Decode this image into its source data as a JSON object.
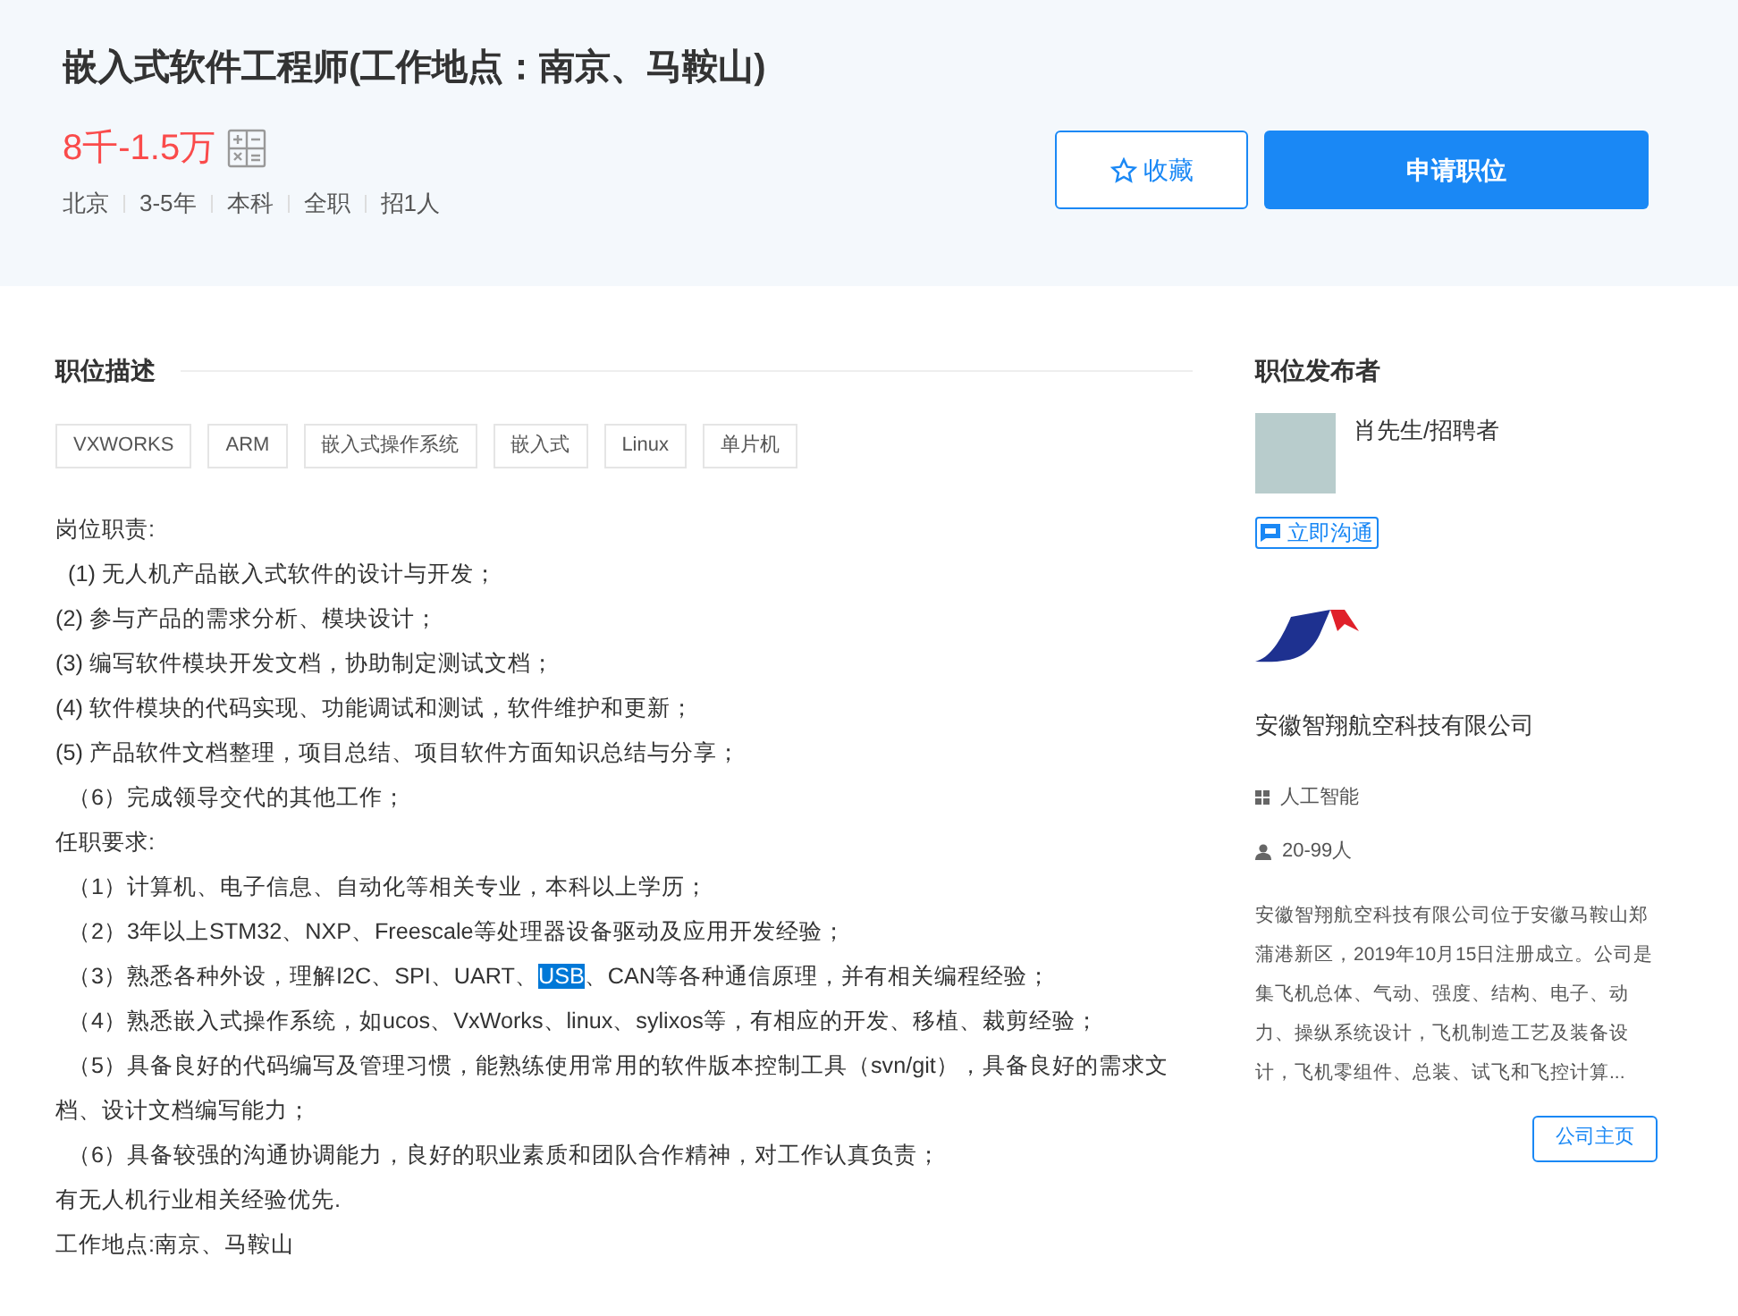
{
  "job": {
    "title": "嵌入式软件工程师(工作地点：南京、马鞍山)",
    "salary": "8千-1.5万",
    "meta": [
      "北京",
      "3-5年",
      "本科",
      "全职",
      "招1人"
    ],
    "favorite_button": "收藏",
    "apply_button": "申请职位"
  },
  "description": {
    "heading": "职位描述",
    "tags": [
      "VXWORKS",
      "ARM",
      "嵌入式操作系统",
      "嵌入式",
      "Linux",
      "单片机"
    ],
    "lines": [
      {
        "text": "岗位职责:"
      },
      {
        "text": "  (1) 无人机产品嵌入式软件的设计与开发；"
      },
      {
        "text": "(2) 参与产品的需求分析、模块设计；"
      },
      {
        "text": "(3) 编写软件模块开发文档，协助制定测试文档；"
      },
      {
        "text": "(4) 软件模块的代码实现、功能调试和测试，软件维护和更新；"
      },
      {
        "text": "(5) 产品软件文档整理，项目总结、项目软件方面知识总结与分享；"
      },
      {
        "text": "  （6）完成领导交代的其他工作；"
      },
      {
        "text": "任职要求:"
      },
      {
        "text": "  （1）计算机、电子信息、自动化等相关专业，本科以上学历；"
      },
      {
        "text": "  （2）3年以上STM32、NXP、Freescale等处理器设备驱动及应用开发经验；"
      },
      {
        "segments": [
          {
            "text": "  （3）熟悉各种外设，理解I2C、SPI、UART、",
            "selected": false
          },
          {
            "text": "USB",
            "selected": true
          },
          {
            "text": "、CAN等各种通信原理，并有相关编程经验；",
            "selected": false
          }
        ]
      },
      {
        "text": "  （4）熟悉嵌入式操作系统，如ucos、VxWorks、linux、sylixos等，有相应的开发、移植、裁剪经验；"
      },
      {
        "text": "  （5）具备良好的代码编写及管理习惯，能熟练使用常用的软件版本控制工具（svn/git），具备良好的需求文档、设计文档编写能力；"
      },
      {
        "text": "  （6）具备较强的沟通协调能力，良好的职业素质和团队合作精神，对工作认真负责；"
      },
      {
        "text": "有无人机行业相关经验优先."
      },
      {
        "text": "工作地点:南京、马鞍山"
      }
    ]
  },
  "publisher": {
    "heading": "职位发布者",
    "name": "肖先生/招聘者",
    "chat_button": "立即沟通",
    "company": "安徽智翔航空科技有限公司",
    "industry": "人工智能",
    "size": "20-99人",
    "intro": "安徽智翔航空科技有限公司位于安徽马鞍山郑蒲港新区，2019年10月15日注册成立。公司是集飞机总体、气动、强度、结构、电子、动力、操纵系统设计，飞机制造工艺及装备设计，飞机零组件、总装、试飞和飞控计算...",
    "homepage_button": "公司主页"
  }
}
